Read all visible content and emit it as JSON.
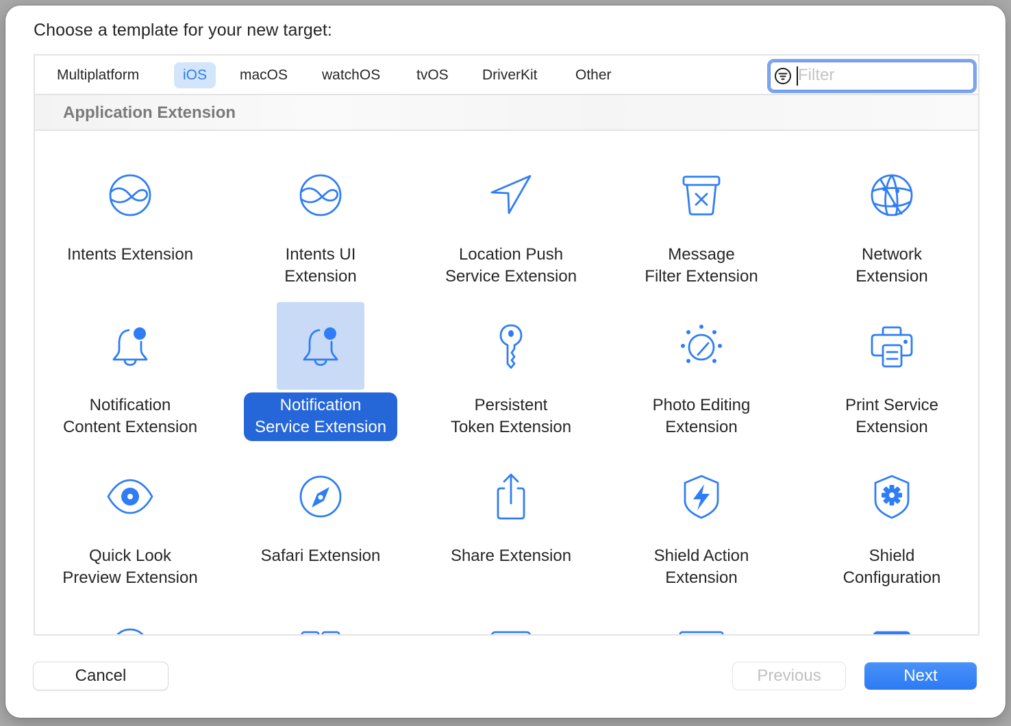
{
  "dialog": {
    "title": "Choose a template for your new target:"
  },
  "tabs": [
    {
      "label": "Multiplatform",
      "selected": false
    },
    {
      "label": "iOS",
      "selected": true
    },
    {
      "label": "macOS",
      "selected": false
    },
    {
      "label": "watchOS",
      "selected": false
    },
    {
      "label": "tvOS",
      "selected": false
    },
    {
      "label": "DriverKit",
      "selected": false
    },
    {
      "label": "Other",
      "selected": false
    }
  ],
  "filter": {
    "icon": "filter-circle-icon",
    "placeholder": "Filter",
    "value": ""
  },
  "section": {
    "title": "Application Extension"
  },
  "templates": [
    {
      "label": "Intents Extension",
      "icon": "intents-icon",
      "selected": false
    },
    {
      "label": "Intents UI\nExtension",
      "icon": "intents-icon",
      "selected": false
    },
    {
      "label": "Location Push\nService Extension",
      "icon": "location-arrow-icon",
      "selected": false
    },
    {
      "label": "Message\nFilter Extension",
      "icon": "message-filter-icon",
      "selected": false
    },
    {
      "label": "Network\nExtension",
      "icon": "network-globe-icon",
      "selected": false
    },
    {
      "label": "Notification\nContent Extension",
      "icon": "notification-bell-icon",
      "selected": false
    },
    {
      "label": "Notification\nService Extension",
      "icon": "notification-bell-icon",
      "selected": true
    },
    {
      "label": "Persistent\nToken Extension",
      "icon": "key-icon",
      "selected": false
    },
    {
      "label": "Photo Editing\nExtension",
      "icon": "photo-editing-dial-icon",
      "selected": false
    },
    {
      "label": "Print Service\nExtension",
      "icon": "printer-icon",
      "selected": false
    },
    {
      "label": "Quick Look\nPreview Extension",
      "icon": "eye-icon",
      "selected": false
    },
    {
      "label": "Safari Extension",
      "icon": "compass-icon",
      "selected": false
    },
    {
      "label": "Share Extension",
      "icon": "share-icon",
      "selected": false
    },
    {
      "label": "Shield Action\nExtension",
      "icon": "shield-bolt-icon",
      "selected": false
    },
    {
      "label": "Shield\nConfiguration",
      "icon": "shield-gear-icon",
      "selected": false
    }
  ],
  "partial_row_icons": [
    "partial-template-icon-1",
    "partial-template-icon-2",
    "partial-template-icon-3",
    "partial-template-icon-4",
    "partial-template-icon-5"
  ],
  "buttons": {
    "cancel": "Cancel",
    "previous": "Previous",
    "next": "Next",
    "previous_enabled": false
  },
  "colors": {
    "accent": "#2f7df6",
    "selection": "#2566d8",
    "tab_selected_bg": "#d3e5fb"
  }
}
